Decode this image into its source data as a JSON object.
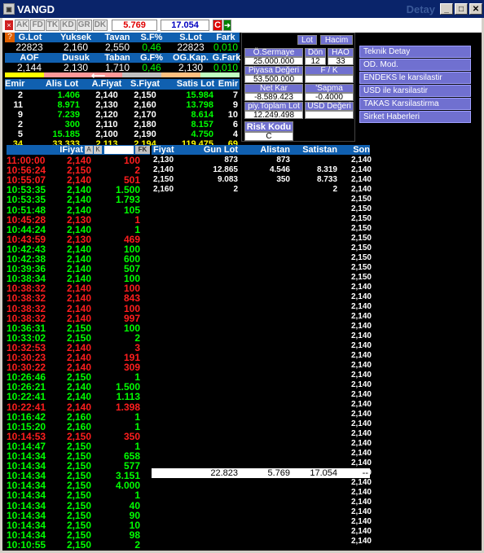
{
  "window": {
    "title": "VANGD",
    "detay": "Detay"
  },
  "toolbar": {
    "buttons": [
      "AK",
      "FD",
      "TK",
      "KD",
      "GR",
      "DK"
    ],
    "val_red": "5.769",
    "val_blue": "17.054",
    "c_btn": "C"
  },
  "top": {
    "h1": [
      "G.Lot",
      "Yuksek",
      "Tavan",
      "S.F%",
      "S.Lot",
      "Fark"
    ],
    "v1": [
      "22823",
      "2,160",
      "2,550",
      "0,46",
      "22823",
      "0,010"
    ],
    "h2": [
      "AOF",
      "Dusuk",
      "Taban",
      "G.F%",
      "OG.Kap.",
      "G.Fark"
    ],
    "v2": [
      "2,144",
      "2,130",
      "1,710",
      "0,46",
      "2,130",
      "0,010"
    ]
  },
  "depth": {
    "headers": [
      "Emir",
      "Alis Lot",
      "A.Fiyat",
      "S.Fiyat",
      "Satis Lot",
      "Emir"
    ],
    "rows": [
      [
        "2",
        "1.406",
        "2,140",
        "2,150",
        "15.984",
        "7"
      ],
      [
        "11",
        "8.971",
        "2,130",
        "2,160",
        "13.798",
        "9"
      ],
      [
        "9",
        "7.239",
        "2,120",
        "2,170",
        "8.614",
        "10"
      ],
      [
        "2",
        "300",
        "2,110",
        "2,180",
        "8.157",
        "6"
      ],
      [
        "5",
        "15.185",
        "2,100",
        "2,190",
        "4.750",
        "4"
      ]
    ],
    "total": [
      "34",
      "33.333",
      "2,113",
      "2,194",
      "119.475",
      "69"
    ]
  },
  "info": {
    "lot": "Lot",
    "hacim": "Hacim",
    "osermaye_l": "Ö.Sermaye",
    "osermaye_v": "25.000.000",
    "don_l": "Dön",
    "don_v": "12",
    "hao_l": "HAO",
    "hao_v": "33",
    "piyasa_l": "Piyasa Değeri",
    "piyasa_v": "53.500.000",
    "fk_l": "F / K",
    "fk_v": "",
    "netkar_l": "Net Kar",
    "netkar_v": "-8.589.423",
    "sapma_l": "'Sapma",
    "sapma_v": "-0.4000",
    "piy_l": "piy.Toplam Lot",
    "piy_v": "12.249.498",
    "usd_l": "USD Değeri",
    "usd_v": "",
    "risk_l": "Risk Kodu",
    "risk_v": "C"
  },
  "right_menu": [
    "Teknik Detay",
    "OD. Mod.",
    "ENDEKS le karsilastir",
    "USD ile karsilastir",
    "TAKAS Karsilastirma",
    "Sirket Haberleri"
  ],
  "trades_header": {
    "fiyat": "IFiyat",
    "a": "A",
    "k": "K",
    "fk": "FK"
  },
  "trades": [
    [
      "11:00:00",
      "2,140",
      "100",
      "r"
    ],
    [
      "10:56:24",
      "2,150",
      "2",
      "r"
    ],
    [
      "10:55:07",
      "2,140",
      "501",
      "r"
    ],
    [
      "10:53:35",
      "2,140",
      "1.500",
      "g"
    ],
    [
      "10:53:35",
      "2,140",
      "1.793",
      "g"
    ],
    [
      "10:51:48",
      "2,140",
      "105",
      "g"
    ],
    [
      "10:45:28",
      "2,130",
      "1",
      "r"
    ],
    [
      "10:44:24",
      "2,140",
      "1",
      "g"
    ],
    [
      "10:43:59",
      "2,130",
      "469",
      "r"
    ],
    [
      "10:42:43",
      "2,140",
      "100",
      "g"
    ],
    [
      "10:42:38",
      "2,140",
      "600",
      "g"
    ],
    [
      "10:39:36",
      "2,140",
      "507",
      "g"
    ],
    [
      "10:38:34",
      "2,140",
      "100",
      "g"
    ],
    [
      "10:38:32",
      "2,140",
      "100",
      "r"
    ],
    [
      "10:38:32",
      "2,140",
      "843",
      "r"
    ],
    [
      "10:38:32",
      "2,140",
      "100",
      "r"
    ],
    [
      "10:38:32",
      "2,140",
      "997",
      "r"
    ],
    [
      "10:36:31",
      "2,150",
      "100",
      "g"
    ],
    [
      "10:33:02",
      "2,150",
      "2",
      "g"
    ],
    [
      "10:32:53",
      "2,140",
      "3",
      "r"
    ],
    [
      "10:30:23",
      "2,140",
      "191",
      "r"
    ],
    [
      "10:30:22",
      "2,140",
      "309",
      "r"
    ],
    [
      "10:26:46",
      "2,150",
      "1",
      "g"
    ],
    [
      "10:26:21",
      "2,140",
      "1.500",
      "g"
    ],
    [
      "10:22:41",
      "2,140",
      "1.113",
      "g"
    ],
    [
      "10:22:41",
      "2,140",
      "1.398",
      "r"
    ],
    [
      "10:16:42",
      "2,160",
      "1",
      "g"
    ],
    [
      "10:15:20",
      "2,160",
      "1",
      "g"
    ],
    [
      "10:14:53",
      "2,150",
      "350",
      "r"
    ],
    [
      "10:14:47",
      "2,150",
      "1",
      "g"
    ],
    [
      "10:14:34",
      "2,150",
      "658",
      "g"
    ],
    [
      "10:14:34",
      "2,150",
      "577",
      "g"
    ],
    [
      "10:14:34",
      "2,150",
      "3.151",
      "g"
    ],
    [
      "10:14:34",
      "2,150",
      "4.000",
      "g"
    ],
    [
      "10:14:34",
      "2,150",
      "1",
      "g"
    ],
    [
      "10:14:34",
      "2,150",
      "40",
      "g"
    ],
    [
      "10:14:34",
      "2,150",
      "90",
      "g"
    ],
    [
      "10:14:34",
      "2,150",
      "10",
      "g"
    ],
    [
      "10:14:34",
      "2,150",
      "98",
      "g"
    ],
    [
      "10:10:55",
      "2,150",
      "2",
      "g"
    ]
  ],
  "dist_header": [
    "Fiyat",
    "Gun Lot",
    "Alistan",
    "Satistan",
    "Son"
  ],
  "dist_rows": [
    [
      "2,130",
      "873",
      "873",
      ""
    ],
    [
      "2,140",
      "12.865",
      "4.546",
      "8.319"
    ],
    [
      "2,150",
      "9.083",
      "350",
      "8.733"
    ],
    [
      "2,160",
      "2",
      "",
      "2"
    ]
  ],
  "dist_total": [
    "22.823",
    "5.769",
    "17.054",
    "--"
  ],
  "son": [
    "2,140",
    "2,140",
    "2,140",
    "2,140",
    "2,150",
    "2,150",
    "2,150",
    "2,150",
    "2,150",
    "2,150",
    "2,150",
    "2,150",
    "2,150",
    "2,140",
    "2,140",
    "2,140",
    "2,140",
    "2,140",
    "2,140",
    "2,140",
    "2,140",
    "2,140",
    "2,140",
    "2,140",
    "2,140",
    "2,140",
    "2,140",
    "2,140",
    "2,140",
    "2,140",
    "2,140",
    "2,140",
    "2,140",
    "2,140",
    "2,140",
    "2,140",
    "2,140",
    "2,140",
    "2,140",
    "2,140"
  ]
}
